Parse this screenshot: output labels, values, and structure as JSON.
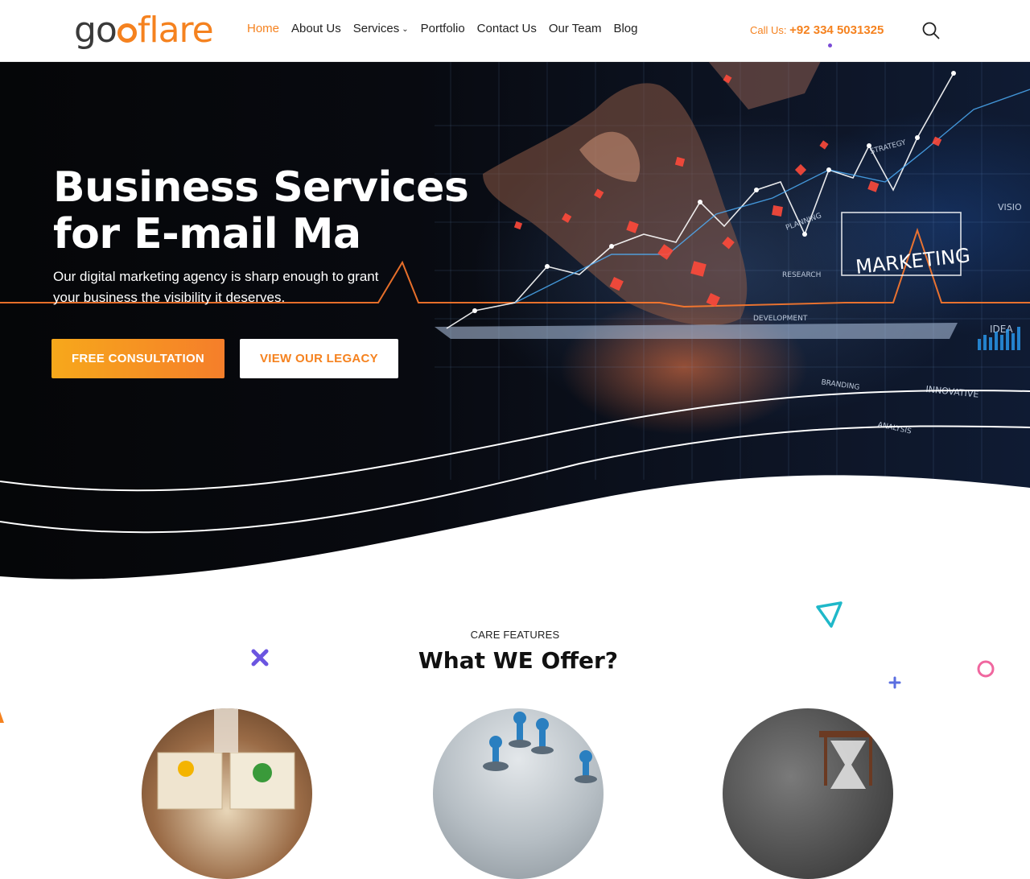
{
  "header": {
    "logo": {
      "part1": "go",
      "part2": "flare"
    },
    "nav": [
      {
        "label": "Home",
        "active": true
      },
      {
        "label": "About Us"
      },
      {
        "label": "Services",
        "dropdown": true
      },
      {
        "label": "Portfolio"
      },
      {
        "label": "Contact Us"
      },
      {
        "label": "Our Team"
      },
      {
        "label": "Blog"
      }
    ],
    "call_label": "Call Us:",
    "call_number": "+92 334 5031325",
    "search_icon": "search-icon"
  },
  "hero": {
    "title": "Business Services for E-mail Ma",
    "subtitle": "Our digital marketing agency is sharp enough to grant your business the visibility it deserves.",
    "primary_button": "FREE CONSULTATION",
    "secondary_button": "VIEW OUR LEGACY",
    "image_labels": {
      "marketing": "MARKETING",
      "strategy": "STRATEGY",
      "planning": "PLANNING",
      "research": "RESEARCH",
      "development": "DEVELOPMENT",
      "branding": "BRANDING",
      "innovative": "INNOVATIVE",
      "analysis": "ANALYSIS",
      "idea": "IDEA",
      "vision": "VISIO"
    }
  },
  "features": {
    "kicker": "CARE FEATURES",
    "title": "What WE Offer?"
  },
  "colors": {
    "accent": "#f5821f",
    "accent_gradient_start": "#f7a81b",
    "hero_bg": "#07090e",
    "nav_text": "#222222"
  }
}
